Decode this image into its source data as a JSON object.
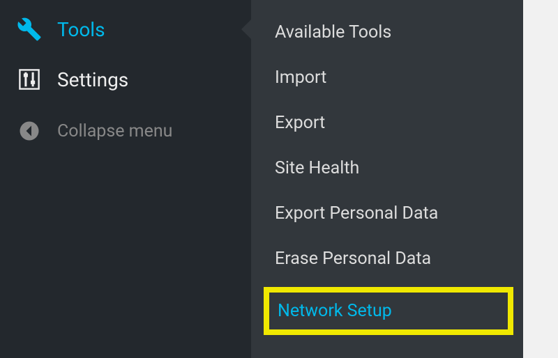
{
  "colors": {
    "accent": "#00b9eb",
    "sidebar_bg": "#23282d",
    "submenu_bg": "#32373c",
    "highlight_border": "#f0e800"
  },
  "sidebar": {
    "items": [
      {
        "label": "Tools",
        "icon": "wrench-icon",
        "active": true
      },
      {
        "label": "Settings",
        "icon": "sliders-icon",
        "active": false
      }
    ],
    "collapse_label": "Collapse menu"
  },
  "submenu": {
    "items": [
      {
        "label": "Available Tools"
      },
      {
        "label": "Import"
      },
      {
        "label": "Export"
      },
      {
        "label": "Site Health"
      },
      {
        "label": "Export Personal Data"
      },
      {
        "label": "Erase Personal Data"
      },
      {
        "label": "Network Setup",
        "highlighted": true
      }
    ]
  }
}
